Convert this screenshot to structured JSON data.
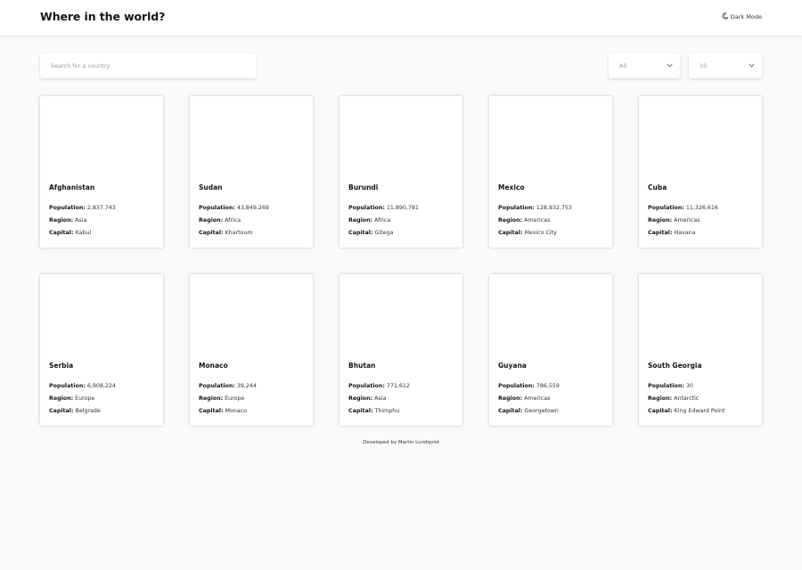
{
  "header": {
    "title": "Where in the world?",
    "dark_mode_label": "Dark Mode"
  },
  "search": {
    "placeholder": "Search for a country"
  },
  "filters": {
    "region_value": "All",
    "count_value": "10"
  },
  "labels": {
    "population": "Population:",
    "region": "Region:",
    "capital": "Capital:"
  },
  "countries": [
    {
      "name": "Afghanistan",
      "population": "2,837,743",
      "region": "Asia",
      "capital": "Kabul"
    },
    {
      "name": "Sudan",
      "population": "43,849,269",
      "region": "Africa",
      "capital": "Khartoum"
    },
    {
      "name": "Burundi",
      "population": "11,890,781",
      "region": "Africa",
      "capital": "Gitega"
    },
    {
      "name": "Mexico",
      "population": "128,932,753",
      "region": "Americas",
      "capital": "Mexico City"
    },
    {
      "name": "Cuba",
      "population": "11,326,616",
      "region": "Americas",
      "capital": "Havana"
    },
    {
      "name": "Serbia",
      "population": "6,908,224",
      "region": "Europe",
      "capital": "Belgrade"
    },
    {
      "name": "Monaco",
      "population": "39,244",
      "region": "Europe",
      "capital": "Monaco"
    },
    {
      "name": "Bhutan",
      "population": "771,612",
      "region": "Asia",
      "capital": "Thimphu"
    },
    {
      "name": "Guyana",
      "population": "786,559",
      "region": "Americas",
      "capital": "Georgetown"
    },
    {
      "name": "South Georgia",
      "population": "30",
      "region": "Antarctic",
      "capital": "King Edward Point"
    }
  ],
  "footer": {
    "text": "Developed by Martin Lundqvist"
  }
}
